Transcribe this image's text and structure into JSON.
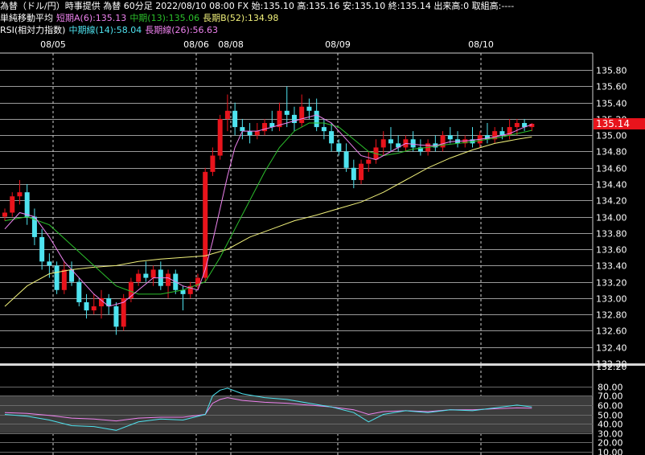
{
  "header": {
    "line1": "為替（ドル/円）時事提供 為替 60分足 2022/08/10 08:00 FX 始:135.10 高:135.16 安:135.10 終:135.14 出来高:0 取組高:----",
    "ma_label": "単純移動平均",
    "ma_short": "短期A(6):135.13",
    "ma_mid": "中期(13):135.06",
    "ma_long": "長期B(52):134.98",
    "rsi_label": "RSI(相対力指数)",
    "rsi_mid": "中期線(14):58.04",
    "rsi_long": "長期線(26):56.63"
  },
  "colors": {
    "background": "#000000",
    "grid": "#9a9a9a",
    "up_candle": "#e8141c",
    "down_candle": "#4fe3ef",
    "ma_short": "#ee82ee",
    "ma_mid": "#2cc12c",
    "ma_long": "#f0f07a",
    "rsi_mid": "#4fe3ef",
    "rsi_long": "#ee82ee",
    "last_price_bg": "#e8141c",
    "rsi_band": "#3c3c3c"
  },
  "chart_data": [
    {
      "type": "candlestick",
      "x_labels": [
        "08/05",
        "08/06",
        "08/08",
        "08/09",
        "08/10"
      ],
      "ylim": [
        132.2,
        135.9
      ],
      "y_ticks": [
        "135.80",
        "135.60",
        "135.40",
        "135.20",
        "135.00",
        "134.80",
        "134.60",
        "134.40",
        "134.20",
        "134.00",
        "133.80",
        "133.60",
        "133.40",
        "133.20",
        "133.00",
        "132.80",
        "132.60",
        "132.40",
        "132.20"
      ],
      "last_price": "135.14",
      "candles_ohlc": [
        [
          134.0,
          134.1,
          133.95,
          134.05
        ],
        [
          134.05,
          134.3,
          134.0,
          134.25
        ],
        [
          134.25,
          134.45,
          134.15,
          134.3
        ],
        [
          134.3,
          134.4,
          133.9,
          134.0
        ],
        [
          134.0,
          134.1,
          133.65,
          133.75
        ],
        [
          133.75,
          133.85,
          133.35,
          133.45
        ],
        [
          133.45,
          133.55,
          133.25,
          133.4
        ],
        [
          133.4,
          133.45,
          133.05,
          133.1
        ],
        [
          133.1,
          133.45,
          133.05,
          133.35
        ],
        [
          133.35,
          133.45,
          133.15,
          133.2
        ],
        [
          133.2,
          133.25,
          132.9,
          132.95
        ],
        [
          132.95,
          133.05,
          132.75,
          132.85
        ],
        [
          132.85,
          133.05,
          132.8,
          132.9
        ],
        [
          132.9,
          133.1,
          132.75,
          133.0
        ],
        [
          133.0,
          133.05,
          132.8,
          132.9
        ],
        [
          132.9,
          132.95,
          132.55,
          132.65
        ],
        [
          132.65,
          133.05,
          132.6,
          133.0
        ],
        [
          133.0,
          133.25,
          132.95,
          133.2
        ],
        [
          133.2,
          133.35,
          133.15,
          133.3
        ],
        [
          133.3,
          133.45,
          133.2,
          133.25
        ],
        [
          133.25,
          133.4,
          133.15,
          133.35
        ],
        [
          133.35,
          133.45,
          133.1,
          133.15
        ],
        [
          133.15,
          133.35,
          133.0,
          133.3
        ],
        [
          133.3,
          133.35,
          133.05,
          133.1
        ],
        [
          133.1,
          133.15,
          132.85,
          133.05
        ],
        [
          133.05,
          133.2,
          133.0,
          133.15
        ],
        [
          133.15,
          133.3,
          133.1,
          133.25
        ],
        [
          133.25,
          134.6,
          133.2,
          134.55
        ],
        [
          134.55,
          134.85,
          134.5,
          134.75
        ],
        [
          134.75,
          135.25,
          134.7,
          135.2
        ],
        [
          135.2,
          135.5,
          135.05,
          135.3
        ],
        [
          135.3,
          135.4,
          135.0,
          135.1
        ],
        [
          135.1,
          135.2,
          134.95,
          135.05
        ],
        [
          135.05,
          135.15,
          134.9,
          135.0
        ],
        [
          135.0,
          135.15,
          134.95,
          135.05
        ],
        [
          135.05,
          135.2,
          135.0,
          135.15
        ],
        [
          135.15,
          135.3,
          135.05,
          135.1
        ],
        [
          135.1,
          135.4,
          135.05,
          135.3
        ],
        [
          135.3,
          135.6,
          135.1,
          135.25
        ],
        [
          135.25,
          135.35,
          135.05,
          135.15
        ],
        [
          135.15,
          135.5,
          135.1,
          135.35
        ],
        [
          135.35,
          135.45,
          135.2,
          135.3
        ],
        [
          135.3,
          135.45,
          135.05,
          135.1
        ],
        [
          135.1,
          135.2,
          134.95,
          135.05
        ],
        [
          135.05,
          135.15,
          134.8,
          134.9
        ],
        [
          134.9,
          134.95,
          134.75,
          134.8
        ],
        [
          134.8,
          134.9,
          134.55,
          134.6
        ],
        [
          134.6,
          134.7,
          134.35,
          134.45
        ],
        [
          134.45,
          134.7,
          134.4,
          134.65
        ],
        [
          134.65,
          134.8,
          134.55,
          134.7
        ],
        [
          134.7,
          134.95,
          134.65,
          134.85
        ],
        [
          134.85,
          135.05,
          134.75,
          134.95
        ],
        [
          134.95,
          135.1,
          134.8,
          134.9
        ],
        [
          134.9,
          135.0,
          134.8,
          134.85
        ],
        [
          134.85,
          135.0,
          134.8,
          134.95
        ],
        [
          134.95,
          135.05,
          134.8,
          134.85
        ],
        [
          134.85,
          134.95,
          134.75,
          134.8
        ],
        [
          134.8,
          134.95,
          134.75,
          134.9
        ],
        [
          134.9,
          135.0,
          134.8,
          134.85
        ],
        [
          134.85,
          135.05,
          134.8,
          135.0
        ],
        [
          135.0,
          135.1,
          134.9,
          134.95
        ],
        [
          134.95,
          135.05,
          134.85,
          134.9
        ],
        [
          134.9,
          135.0,
          134.85,
          134.95
        ],
        [
          134.95,
          135.1,
          134.85,
          134.9
        ],
        [
          134.9,
          135.05,
          134.85,
          135.0
        ],
        [
          135.0,
          135.15,
          134.9,
          134.95
        ],
        [
          134.95,
          135.1,
          134.9,
          135.05
        ],
        [
          135.05,
          135.1,
          134.95,
          135.0
        ],
        [
          135.0,
          135.2,
          134.95,
          135.1
        ],
        [
          135.1,
          135.2,
          135.0,
          135.15
        ],
        [
          135.15,
          135.2,
          135.05,
          135.1
        ],
        [
          135.1,
          135.15,
          135.05,
          135.14
        ]
      ],
      "ma_short": [
        [
          0,
          133.85
        ],
        [
          2,
          134.05
        ],
        [
          4,
          134.0
        ],
        [
          6,
          133.75
        ],
        [
          8,
          133.45
        ],
        [
          10,
          133.25
        ],
        [
          12,
          133.05
        ],
        [
          14,
          132.9
        ],
        [
          16,
          132.95
        ],
        [
          18,
          133.1
        ],
        [
          20,
          133.25
        ],
        [
          22,
          133.25
        ],
        [
          24,
          133.15
        ],
        [
          26,
          133.1
        ],
        [
          27,
          133.35
        ],
        [
          28,
          133.7
        ],
        [
          29,
          134.1
        ],
        [
          30,
          134.5
        ],
        [
          31,
          134.85
        ],
        [
          32,
          135.05
        ],
        [
          34,
          135.05
        ],
        [
          36,
          135.1
        ],
        [
          38,
          135.15
        ],
        [
          40,
          135.2
        ],
        [
          42,
          135.25
        ],
        [
          44,
          135.15
        ],
        [
          46,
          134.95
        ],
        [
          48,
          134.75
        ],
        [
          50,
          134.7
        ],
        [
          52,
          134.8
        ],
        [
          54,
          134.9
        ],
        [
          56,
          134.88
        ],
        [
          58,
          134.87
        ],
        [
          60,
          134.92
        ],
        [
          62,
          134.93
        ],
        [
          64,
          134.95
        ],
        [
          66,
          134.98
        ],
        [
          68,
          135.02
        ],
        [
          70,
          135.1
        ],
        [
          71,
          135.13
        ]
      ],
      "ma_mid": [
        [
          0,
          133.95
        ],
        [
          3,
          134.0
        ],
        [
          6,
          133.9
        ],
        [
          9,
          133.65
        ],
        [
          12,
          133.4
        ],
        [
          15,
          133.15
        ],
        [
          18,
          133.05
        ],
        [
          21,
          133.05
        ],
        [
          24,
          133.1
        ],
        [
          27,
          133.2
        ],
        [
          29,
          133.5
        ],
        [
          31,
          133.85
        ],
        [
          33,
          134.2
        ],
        [
          35,
          134.55
        ],
        [
          37,
          134.85
        ],
        [
          39,
          135.05
        ],
        [
          41,
          135.15
        ],
        [
          43,
          135.15
        ],
        [
          45,
          135.1
        ],
        [
          47,
          134.95
        ],
        [
          49,
          134.8
        ],
        [
          51,
          134.75
        ],
        [
          53,
          134.78
        ],
        [
          55,
          134.83
        ],
        [
          57,
          134.85
        ],
        [
          59,
          134.88
        ],
        [
          61,
          134.9
        ],
        [
          63,
          134.92
        ],
        [
          65,
          134.95
        ],
        [
          67,
          134.98
        ],
        [
          69,
          135.02
        ],
        [
          71,
          135.06
        ]
      ],
      "ma_long": [
        [
          0,
          132.9
        ],
        [
          3,
          133.15
        ],
        [
          6,
          133.3
        ],
        [
          9,
          133.35
        ],
        [
          12,
          133.38
        ],
        [
          15,
          133.4
        ],
        [
          18,
          133.45
        ],
        [
          21,
          133.48
        ],
        [
          24,
          133.5
        ],
        [
          27,
          133.52
        ],
        [
          30,
          133.6
        ],
        [
          33,
          133.75
        ],
        [
          36,
          133.85
        ],
        [
          39,
          133.95
        ],
        [
          42,
          134.02
        ],
        [
          45,
          134.1
        ],
        [
          48,
          134.18
        ],
        [
          51,
          134.3
        ],
        [
          54,
          134.45
        ],
        [
          57,
          134.6
        ],
        [
          60,
          134.72
        ],
        [
          63,
          134.82
        ],
        [
          66,
          134.9
        ],
        [
          69,
          134.95
        ],
        [
          71,
          134.98
        ]
      ]
    },
    {
      "type": "line",
      "name": "RSI",
      "ylim": [
        10,
        90
      ],
      "y_ticks": [
        "80.00",
        "70.00",
        "60.00",
        "50.00",
        "40.00",
        "30.00",
        "20.00",
        "10.00"
      ],
      "band": [
        30,
        70
      ],
      "rsi_mid": [
        [
          0,
          50
        ],
        [
          3,
          48
        ],
        [
          6,
          44
        ],
        [
          9,
          38
        ],
        [
          12,
          37
        ],
        [
          15,
          33
        ],
        [
          18,
          42
        ],
        [
          21,
          45
        ],
        [
          24,
          44
        ],
        [
          27,
          50
        ],
        [
          28,
          70
        ],
        [
          29,
          76
        ],
        [
          30,
          78
        ],
        [
          32,
          72
        ],
        [
          35,
          68
        ],
        [
          38,
          66
        ],
        [
          41,
          62
        ],
        [
          44,
          58
        ],
        [
          47,
          52
        ],
        [
          49,
          42
        ],
        [
          51,
          50
        ],
        [
          54,
          54
        ],
        [
          57,
          52
        ],
        [
          60,
          55
        ],
        [
          63,
          54
        ],
        [
          66,
          57
        ],
        [
          69,
          60
        ],
        [
          71,
          58.04
        ]
      ],
      "rsi_long": [
        [
          0,
          52
        ],
        [
          3,
          51
        ],
        [
          6,
          49
        ],
        [
          9,
          46
        ],
        [
          12,
          45
        ],
        [
          15,
          43
        ],
        [
          18,
          46
        ],
        [
          21,
          47
        ],
        [
          24,
          47
        ],
        [
          27,
          50
        ],
        [
          28,
          62
        ],
        [
          29,
          66
        ],
        [
          30,
          68
        ],
        [
          32,
          65
        ],
        [
          35,
          63
        ],
        [
          38,
          62
        ],
        [
          41,
          60
        ],
        [
          44,
          58
        ],
        [
          47,
          55
        ],
        [
          49,
          50
        ],
        [
          51,
          53
        ],
        [
          54,
          54
        ],
        [
          57,
          53
        ],
        [
          60,
          55
        ],
        [
          63,
          55
        ],
        [
          66,
          56
        ],
        [
          69,
          57
        ],
        [
          71,
          56.63
        ]
      ]
    }
  ]
}
